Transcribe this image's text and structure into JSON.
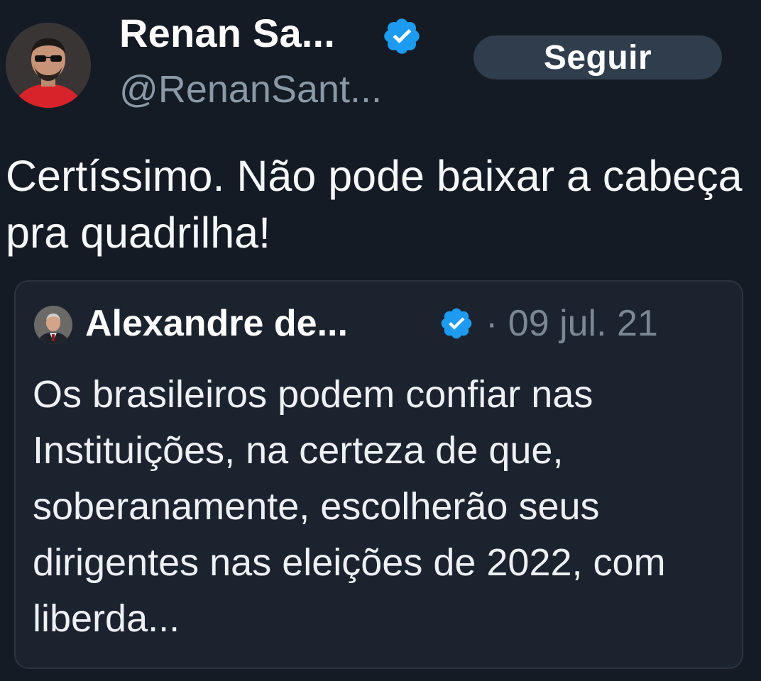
{
  "tweet": {
    "author": {
      "display_name": "Renan Sa...",
      "handle": "@RenanSant...",
      "verified": true,
      "avatar_icon": "profile-photo-man-sunglasses-red-shirt"
    },
    "follow_label": "Seguir",
    "text": "Certíssimo. Não pode baixar a cabeça pra quadrilha!",
    "quoted_tweet": {
      "author": {
        "display_name": "Alexandre de...",
        "verified": true,
        "avatar_icon": "profile-photo-man-suit"
      },
      "separator": "·",
      "date": "09 jul. 21",
      "text": "Os brasileiros podem confiar nas Instituições, na certeza de que, soberanamente, escolherão seus dirigentes nas eleições de 2022, com liberda..."
    }
  },
  "colors": {
    "background": "#141b24",
    "verified_badge": "#1d9bf0",
    "follow_button_bg": "#303d4d",
    "secondary_text": "#8b98a5"
  }
}
